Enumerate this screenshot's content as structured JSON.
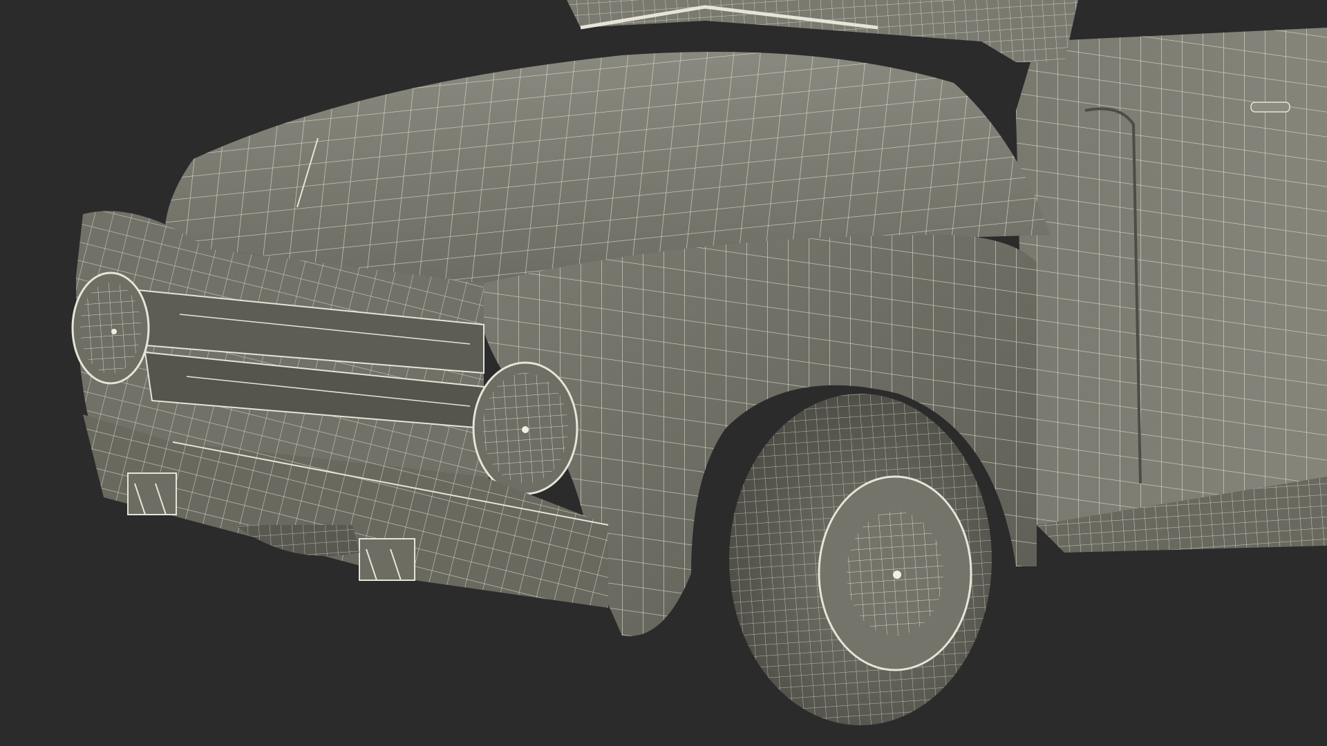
{
  "scene": {
    "subject": "",
    "colors": {
      "background": "#2b2b2b",
      "body": "#6f6e64",
      "body_light": "#8a897e",
      "body_dark": "#4e4d46",
      "wire": "#e9e8dc",
      "tire": "#5e5d55"
    }
  }
}
